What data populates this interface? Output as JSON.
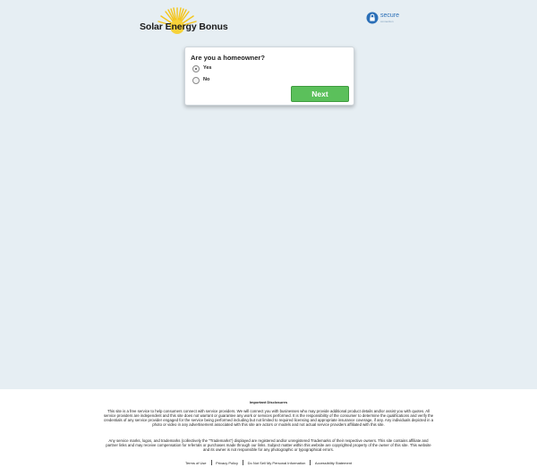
{
  "header": {
    "logo_text": "Solar Energy Bonus",
    "secure_badge": {
      "label": "secure",
      "sub": "connection"
    }
  },
  "form": {
    "question": "Are you a homeowner?",
    "options": [
      {
        "label": "Yes",
        "selected": true
      },
      {
        "label": "No",
        "selected": false
      }
    ],
    "next_label": "Next"
  },
  "footer": {
    "disclosures_title": "Important Disclosures",
    "paragraph1": "This site is a free service to help consumers connect with service providers. We will connect you with businesses who may provide additional product details and/or assist you with quotes. All service providers are independent and this site does not warrant or guarantee any work or services performed. It is the responsibility of the consumer to determine the qualifications and verify the credentials of any service provider engaged for the service being performed including but not limited to required licensing and appropriate insurance coverage, if any. Any individuals depicted in a photo or video in any advertisement associated with this site are actors or models and not actual service providers affiliated with this site.",
    "paragraph2": "Any service marks, logos, and trademarks (collectively the \"Trademarks\") displayed are registered and/or unregistered Trademarks of their respective owners. This site contains affiliate and partner links and may receive compensation for referrals or purchases made through our links. Subject matter within this website are copyrighted property of the owner of this site. This website and its owner is not responsible for any photographic or typographical errors.",
    "links": [
      {
        "label": "Terms of Use"
      },
      {
        "label": "Privacy Policy"
      },
      {
        "label": "Do Not Sell My Personal Information"
      },
      {
        "label": "Accessibility Statement"
      }
    ]
  },
  "colors": {
    "page_bg": "#e6eef3",
    "next_button": "#5bc05b",
    "sun": "#f5c518",
    "secure_blue": "#2b6fb7"
  }
}
